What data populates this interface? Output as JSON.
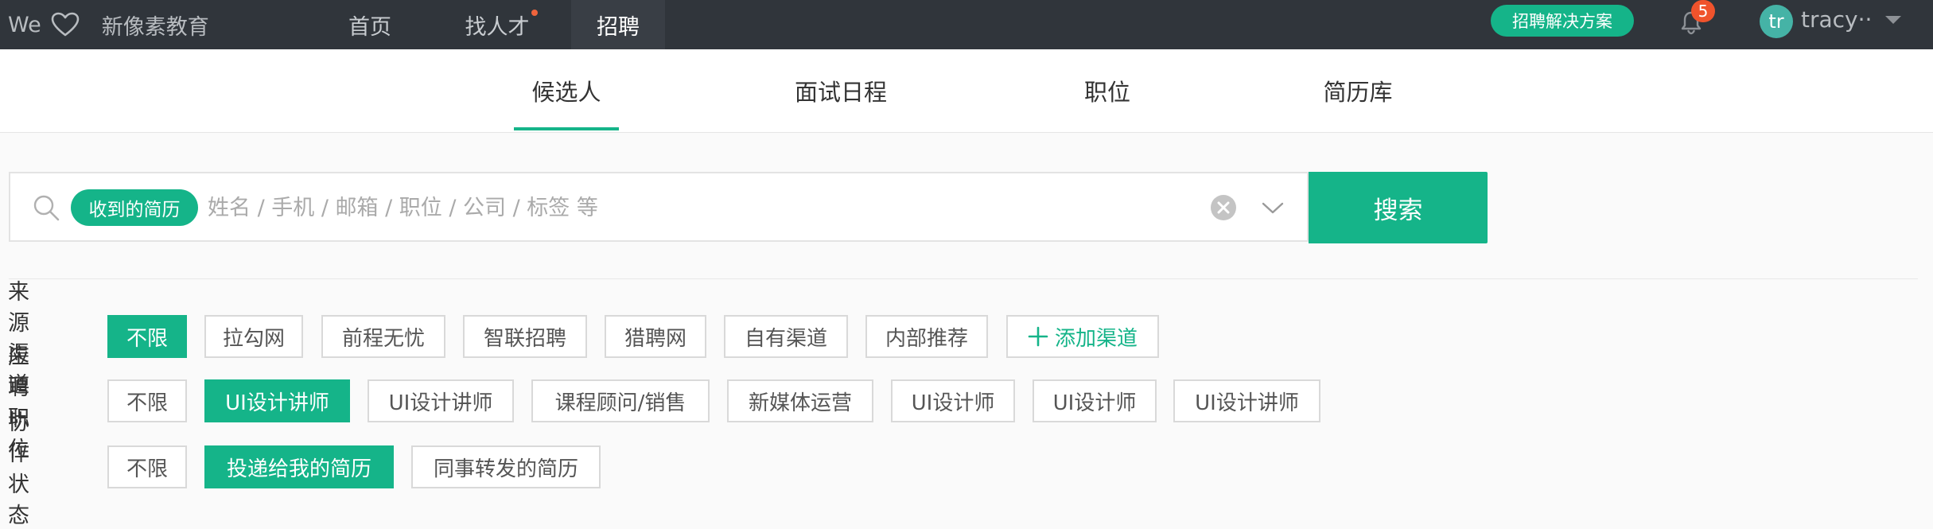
{
  "colors": {
    "accent": "#15b489",
    "topbar": "#30353b",
    "notify": "#f0532c"
  },
  "brand": {
    "logo_text": "We",
    "logo_icon": "heart-icon",
    "org_name": "新像素教育"
  },
  "topnav": [
    {
      "label": "首页",
      "dot": false,
      "active": false
    },
    {
      "label": "找人才",
      "dot": true,
      "active": false
    },
    {
      "label": "招聘",
      "dot": false,
      "active": true
    }
  ],
  "header_right": {
    "solution_label": "招聘解决方案",
    "notification_icon": "bell-icon",
    "notification_count": "5",
    "avatar_initials": "tr",
    "username": "tracy··"
  },
  "tabs": [
    {
      "label": "候选人",
      "active": true
    },
    {
      "label": "面试日程",
      "active": false
    },
    {
      "label": "职位",
      "active": false
    },
    {
      "label": "简历库",
      "active": false
    }
  ],
  "search": {
    "scope_tag": "收到的简历",
    "value": "",
    "placeholder": "姓名 / 手机 / 邮箱 / 职位 / 公司 / 标签 等",
    "button_label": "搜索"
  },
  "filters": {
    "source": {
      "label": "来源渠道",
      "options": [
        {
          "label": "不限",
          "active": true
        },
        {
          "label": "拉勾网",
          "active": false
        },
        {
          "label": "前程无忧",
          "active": false
        },
        {
          "label": "智联招聘",
          "active": false
        },
        {
          "label": "猎聘网",
          "active": false
        },
        {
          "label": "自有渠道",
          "active": false
        },
        {
          "label": "内部推荐",
          "active": false
        }
      ],
      "add_label": "添加渠道"
    },
    "position": {
      "label": "应聘职位",
      "options": [
        {
          "label": "不限",
          "active": false
        },
        {
          "label": "UI设计讲师",
          "active": true
        },
        {
          "label": "UI设计讲师",
          "active": false
        },
        {
          "label": "课程顾问/销售",
          "active": false
        },
        {
          "label": "新媒体运营",
          "active": false
        },
        {
          "label": "UI设计师",
          "active": false
        },
        {
          "label": "UI设计师",
          "active": false
        },
        {
          "label": "UI设计讲师",
          "active": false
        }
      ]
    },
    "collab": {
      "label": "协作状态",
      "options": [
        {
          "label": "不限",
          "active": false
        },
        {
          "label": "投递给我的简历",
          "active": true
        },
        {
          "label": "同事转发的简历",
          "active": false
        }
      ]
    }
  }
}
